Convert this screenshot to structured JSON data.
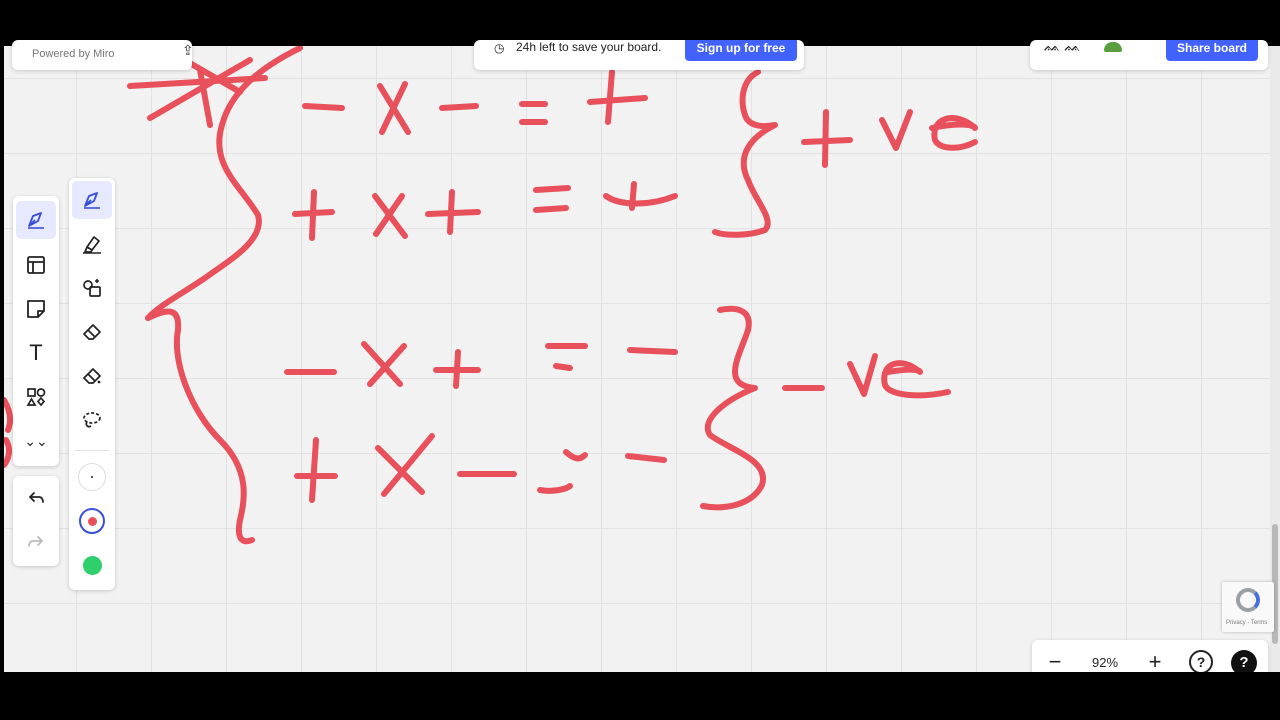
{
  "branding": {
    "powered_by": "Powered by Miro"
  },
  "topbar": {
    "timer_icon": "clock-icon",
    "timer_message": "24h left to save your board.",
    "signup_label": "Sign up for free",
    "share_label": "Share board",
    "reactions_icon": "reactions-icon",
    "avatar": "user-avatar"
  },
  "left_toolbar": {
    "items": [
      {
        "name": "select-pen",
        "icon": "pen-icon",
        "active": true
      },
      {
        "name": "templates",
        "icon": "frame-icon"
      },
      {
        "name": "sticky-note",
        "icon": "sticky-note-icon"
      },
      {
        "name": "text",
        "icon": "text-icon",
        "glyph": "T"
      },
      {
        "name": "shapes",
        "icon": "shapes-icon"
      },
      {
        "name": "more",
        "icon": "chevron-down-icon"
      }
    ],
    "undo_icon": "undo-icon",
    "redo_icon": "redo-icon"
  },
  "pen_toolbar": {
    "tools": [
      "pen-icon",
      "highlighter-icon",
      "smart-draw-icon",
      "eraser-icon",
      "object-eraser-icon",
      "lasso-icon"
    ],
    "stroke_sizes": [
      "thin"
    ],
    "colors": [
      "#e8505b",
      "#2fd06c"
    ]
  },
  "zoom": {
    "level": "92%",
    "minus": "−",
    "plus": "+",
    "help": "?"
  },
  "recaptcha": {
    "terms": "Privacy - Terms"
  },
  "colors": {
    "ink": "#e8505b",
    "accent": "#4262ff",
    "canvas": "#f2f2f2"
  }
}
